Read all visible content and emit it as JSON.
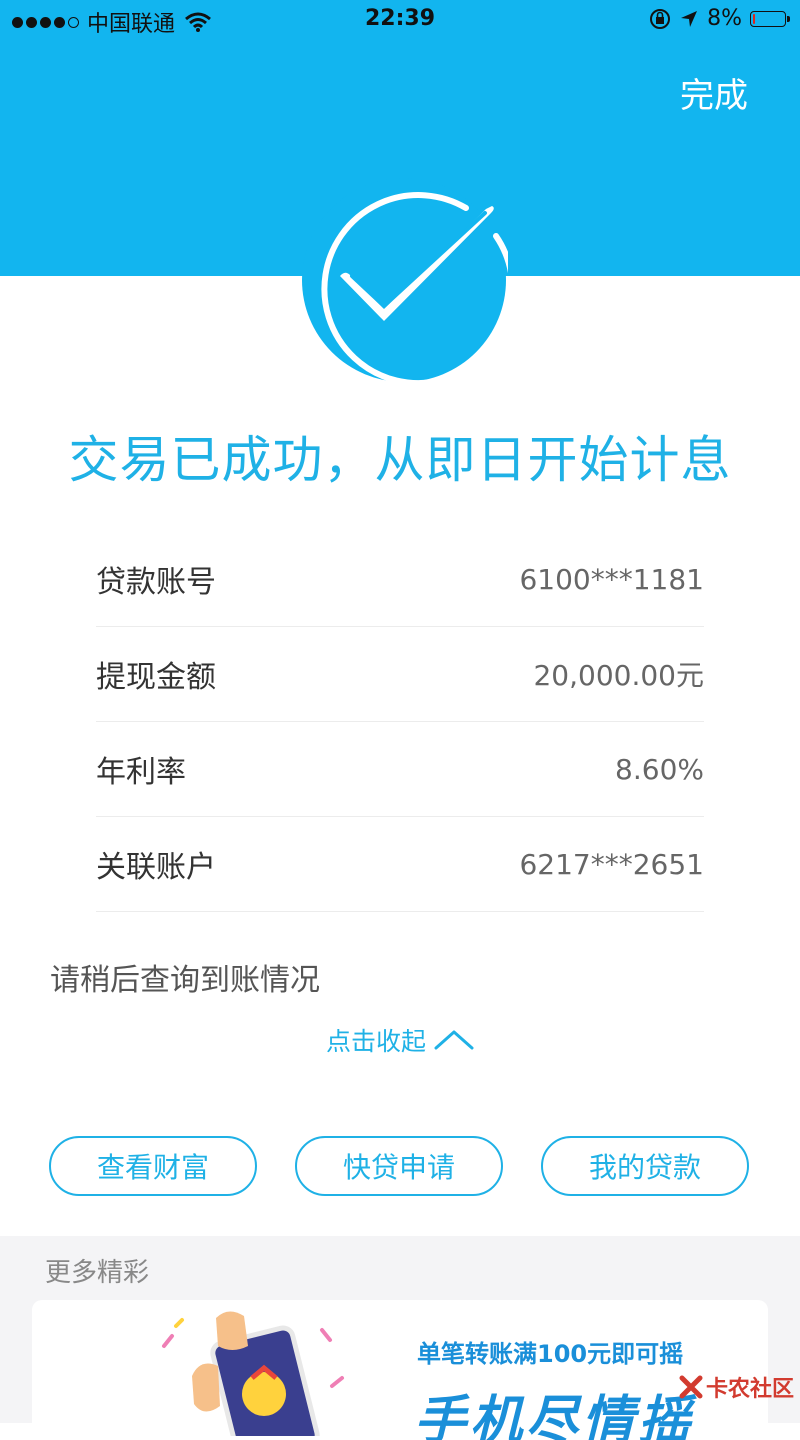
{
  "status_bar": {
    "carrier": "中国联通",
    "time": "22:39",
    "battery": "8%",
    "battery_level": 0.08,
    "icons": [
      "signal-dots",
      "wifi-icon",
      "orientation-lock-icon",
      "location-arrow-icon",
      "battery-icon"
    ]
  },
  "header": {
    "done_label": "完成",
    "accent_color": "#12b5ef"
  },
  "result": {
    "headline": "交易已成功，从即日开始计息",
    "icon": "checkmark-icon"
  },
  "details": [
    {
      "label": "贷款账号",
      "value": "6100***1181"
    },
    {
      "label": "提现金额",
      "value": "20,000.00元"
    },
    {
      "label": "年利率",
      "value": "8.60%"
    },
    {
      "label": "关联账户",
      "value": "6217***2651"
    }
  ],
  "notice": "请稍后查询到账情况",
  "collapse_label": "点击收起",
  "actions": [
    {
      "label": "查看财富"
    },
    {
      "label": "快贷申请"
    },
    {
      "label": "我的贷款"
    }
  ],
  "more": {
    "title": "更多精彩",
    "promo": {
      "subtitle": "单笔转账满100元即可摇",
      "title": "手机尽情摇"
    }
  },
  "watermark": "卡农社区"
}
